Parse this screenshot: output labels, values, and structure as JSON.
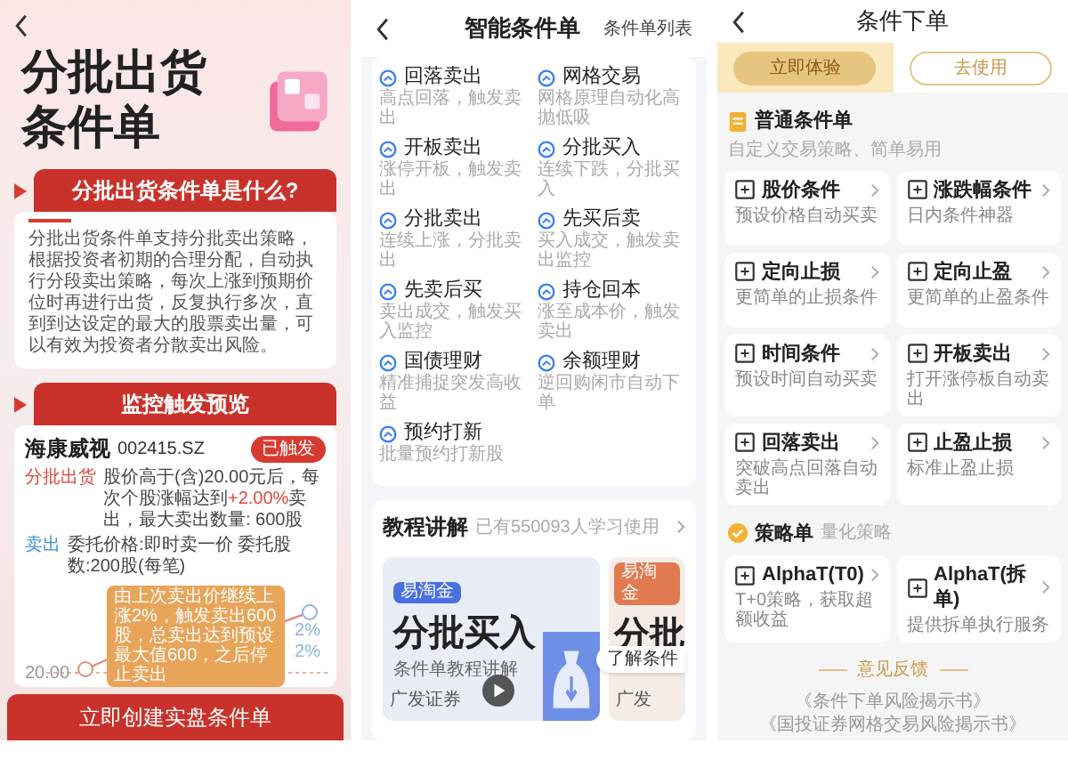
{
  "left_screen": {
    "title": "分批出货条件单",
    "intro": {
      "heading": "分批出货条件单是什么?",
      "body": "分批出货条件单支持分批卖出策略，根据投资者初期的合理分配，自动执行分段卖出策略，每次上涨到预期价位时再进行出货，反复执行多次，直到到达设定的最大的股票卖出量，可以有效为投资者分散卖出风险。"
    },
    "preview": {
      "heading": "监控触发预览",
      "stock_name": "海康威视",
      "stock_code": "002415.SZ",
      "status": "已触发",
      "rows": [
        {
          "label": "分批出货",
          "color": "#e0453a",
          "segments": [
            {
              "text": "股价高于(含)20.00元后，每次个股涨幅达到",
              "highlight": false
            },
            {
              "text": "+2.00%",
              "highlight": true
            },
            {
              "text": "卖出，最大卖出数量: 600股",
              "highlight": false
            }
          ]
        },
        {
          "label": "卖出",
          "color": "#3b8fd9",
          "segments": [
            {
              "text": "委托价格:即时卖一价 委托股数:200股(每笔)",
              "highlight": false
            }
          ]
        }
      ],
      "tooltip": "由上次卖出价继续上涨2%，触发卖出600股，总卖出达到预设最大值600，之后停止卖出",
      "price_label": "20.00",
      "step_labels": [
        "2%",
        "2%"
      ]
    },
    "button": "立即创建实盘条件单"
  },
  "middle_screen": {
    "title": "智能条件单",
    "action": "条件单列表",
    "items": [
      {
        "title": "回落卖出",
        "subtitle": "高点回落，触发卖出"
      },
      {
        "title": "网格交易",
        "subtitle": "网格原理自动化高抛低吸"
      },
      {
        "title": "开板卖出",
        "subtitle": "涨停开板，触发卖出"
      },
      {
        "title": "分批买入",
        "subtitle": "连续下跌，分批买入"
      },
      {
        "title": "分批卖出",
        "subtitle": "连续上涨，分批卖出"
      },
      {
        "title": "先买后卖",
        "subtitle": "买入成交，触发卖出监控"
      },
      {
        "title": "先卖后买",
        "subtitle": "卖出成交，触发买入监控"
      },
      {
        "title": "持仓回本",
        "subtitle": "涨至成本价，触发卖出"
      },
      {
        "title": "国债理财",
        "subtitle": "精准捕捉突发高收益"
      },
      {
        "title": "余额理财",
        "subtitle": "逆回购闲市自动下单"
      },
      {
        "title": "预约打新",
        "subtitle": "批量预约打新股"
      }
    ],
    "tutorial": {
      "heading": "教程讲解",
      "count": "已有550093人学习使用",
      "videos": [
        {
          "badge": "易淘金",
          "title": "分批买入",
          "subtitle": "条件单教程讲解",
          "brand": "广发证券"
        },
        {
          "badge": "易淘金",
          "title": "分批",
          "brand": "广发"
        }
      ],
      "pill": "了解条件"
    }
  },
  "right_screen": {
    "title": "条件下单",
    "buttons": [
      "立即体验",
      "去使用"
    ],
    "sections": [
      {
        "title": "普通条件单",
        "subtitle": "自定义交易策略、简单易用",
        "items": [
          {
            "title": "股价条件",
            "subtitle": "预设价格自动买卖"
          },
          {
            "title": "涨跌幅条件",
            "subtitle": "日内条件神器"
          },
          {
            "title": "定向止损",
            "subtitle": "更简单的止损条件"
          },
          {
            "title": "定向止盈",
            "subtitle": "更简单的止盈条件"
          },
          {
            "title": "时间条件",
            "subtitle": "预设时间自动买卖"
          },
          {
            "title": "开板卖出",
            "subtitle": "打开涨停板自动卖出"
          },
          {
            "title": "回落卖出",
            "subtitle": "突破高点回落自动卖出"
          },
          {
            "title": "止盈止损",
            "subtitle": "标准止盈止损"
          }
        ]
      },
      {
        "title": "策略单",
        "subtitle": "量化策略",
        "items": [
          {
            "title": "AlphaT(T0)",
            "subtitle": "T+0策略，获取超额收益"
          },
          {
            "title": "AlphaT(拆单)",
            "subtitle": "提供拆单执行服务"
          }
        ]
      }
    ],
    "feedback": "意见反馈",
    "links": [
      "《条件下单风险揭示书》",
      "《国投证券网格交易风险揭示书》"
    ]
  }
}
